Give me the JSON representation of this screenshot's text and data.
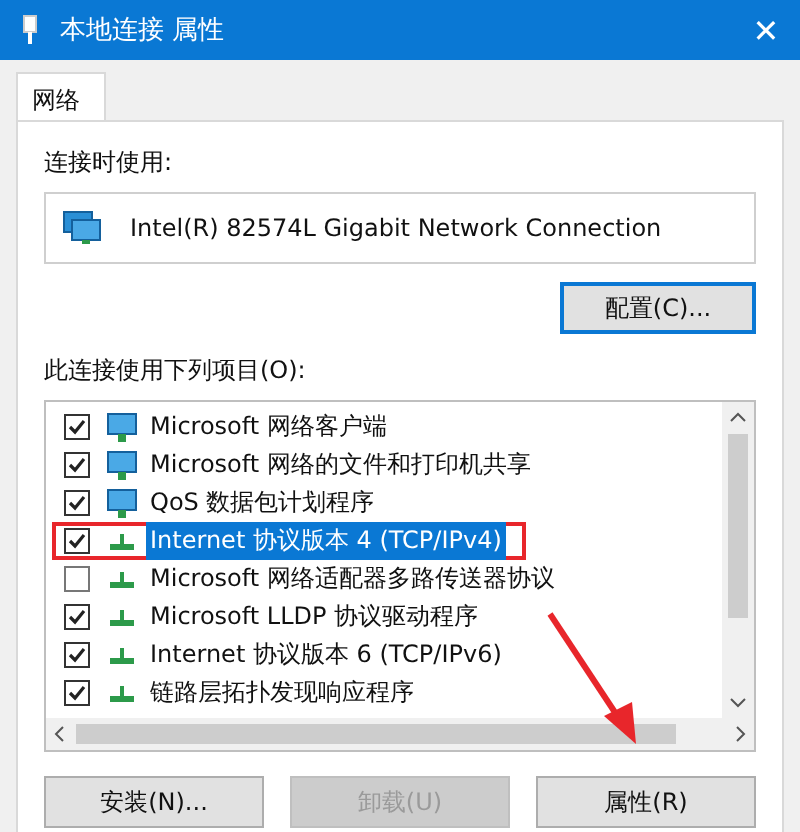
{
  "window": {
    "title": "本地连接 属性",
    "close": "✕"
  },
  "tabs": [
    {
      "label": "网络",
      "selected": true
    }
  ],
  "connect_using": {
    "label": "连接时使用:",
    "adapter": "Intel(R) 82574L Gigabit Network Connection"
  },
  "configure_button": "配置(C)...",
  "items_label": "此连接使用下列项目(O):",
  "items": [
    {
      "label": "Microsoft 网络客户端",
      "kind": "client",
      "checked": true,
      "selected": false,
      "highlighted": false
    },
    {
      "label": "Microsoft 网络的文件和打印机共享",
      "kind": "client",
      "checked": true,
      "selected": false,
      "highlighted": false
    },
    {
      "label": "QoS 数据包计划程序",
      "kind": "client",
      "checked": true,
      "selected": false,
      "highlighted": false
    },
    {
      "label": "Internet 协议版本 4 (TCP/IPv4)",
      "kind": "protocol",
      "checked": true,
      "selected": true,
      "highlighted": true
    },
    {
      "label": "Microsoft 网络适配器多路传送器协议",
      "kind": "protocol",
      "checked": false,
      "selected": false,
      "highlighted": false
    },
    {
      "label": "Microsoft LLDP 协议驱动程序",
      "kind": "protocol",
      "checked": true,
      "selected": false,
      "highlighted": false
    },
    {
      "label": "Internet 协议版本 6 (TCP/IPv6)",
      "kind": "protocol",
      "checked": true,
      "selected": false,
      "highlighted": false
    },
    {
      "label": "链路层拓扑发现响应程序",
      "kind": "protocol",
      "checked": true,
      "selected": false,
      "highlighted": false
    }
  ],
  "buttons": [
    {
      "label": "安装(N)...",
      "disabled": false
    },
    {
      "label": "卸载(U)",
      "disabled": true
    },
    {
      "label": "属性(R)",
      "disabled": false
    }
  ]
}
